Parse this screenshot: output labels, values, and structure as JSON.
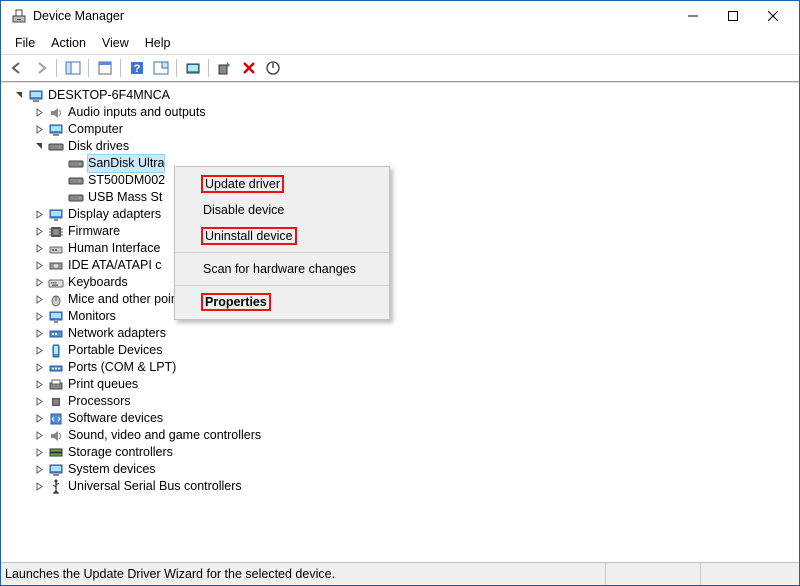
{
  "title": "Device Manager",
  "menu": {
    "file": "File",
    "action": "Action",
    "view": "View",
    "help": "Help"
  },
  "root": "DESKTOP-6F4MNCA",
  "cats": [
    {
      "k": "audio",
      "label": "Audio inputs and outputs",
      "open": false
    },
    {
      "k": "computer",
      "label": "Computer",
      "open": false
    },
    {
      "k": "disk",
      "label": "Disk drives",
      "open": true,
      "children": [
        {
          "k": "sandisk",
          "label": "SanDisk Ultra",
          "sel": true
        },
        {
          "k": "st500",
          "label": "ST500DM002"
        },
        {
          "k": "usbmass",
          "label": "USB Mass  St"
        }
      ]
    },
    {
      "k": "display",
      "label": "Display adapters",
      "open": false
    },
    {
      "k": "firmware",
      "label": "Firmware",
      "open": false
    },
    {
      "k": "hid",
      "label": "Human Interface",
      "open": false
    },
    {
      "k": "ide",
      "label": "IDE ATA/ATAPI c",
      "open": false
    },
    {
      "k": "keyboards",
      "label": "Keyboards",
      "open": false
    },
    {
      "k": "mice",
      "label": "Mice and other pointing devices",
      "open": false
    },
    {
      "k": "monitors",
      "label": "Monitors",
      "open": false
    },
    {
      "k": "network",
      "label": "Network adapters",
      "open": false
    },
    {
      "k": "portable",
      "label": "Portable Devices",
      "open": false
    },
    {
      "k": "ports",
      "label": "Ports (COM & LPT)",
      "open": false
    },
    {
      "k": "printq",
      "label": "Print queues",
      "open": false
    },
    {
      "k": "proc",
      "label": "Processors",
      "open": false
    },
    {
      "k": "softdev",
      "label": "Software devices",
      "open": false
    },
    {
      "k": "sound",
      "label": "Sound, video and game controllers",
      "open": false
    },
    {
      "k": "storage",
      "label": "Storage controllers",
      "open": false
    },
    {
      "k": "sysdev",
      "label": "System devices",
      "open": false
    },
    {
      "k": "usb",
      "label": "Universal Serial Bus controllers",
      "open": false
    }
  ],
  "ctx": {
    "update": "Update driver",
    "disable": "Disable device",
    "uninstall": "Uninstall device",
    "scan": "Scan for hardware changes",
    "props": "Properties"
  },
  "ctx_highlight": [
    "update",
    "uninstall",
    "props"
  ],
  "status": "Launches the Update Driver Wizard for the selected device."
}
